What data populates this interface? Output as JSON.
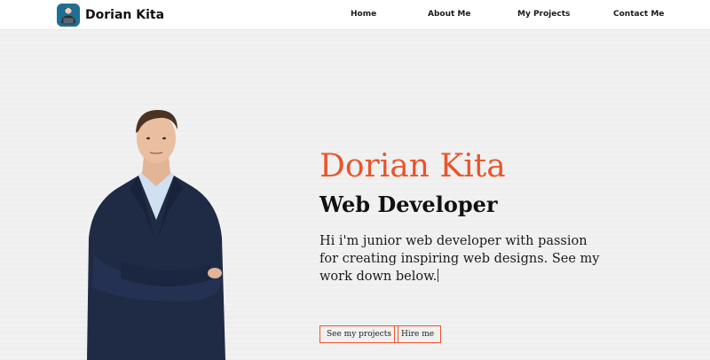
{
  "brand": {
    "name": "Dorian Kita",
    "logo_icon": "developer-avatar-icon",
    "logo_color": "#1f6f94"
  },
  "nav": {
    "items": [
      {
        "label": "Home"
      },
      {
        "label": "About Me"
      },
      {
        "label": "My Projects"
      },
      {
        "label": "Contact Me"
      }
    ]
  },
  "hero": {
    "name": "Dorian Kita",
    "role": "Web Developer",
    "intro": "Hi i'm junior web developer with passion for creating inspiring web designs. See my work down below.",
    "accent_color": "#e8552b",
    "buttons": {
      "projects_label": "See my projects",
      "hire_label": "Hire me"
    }
  }
}
